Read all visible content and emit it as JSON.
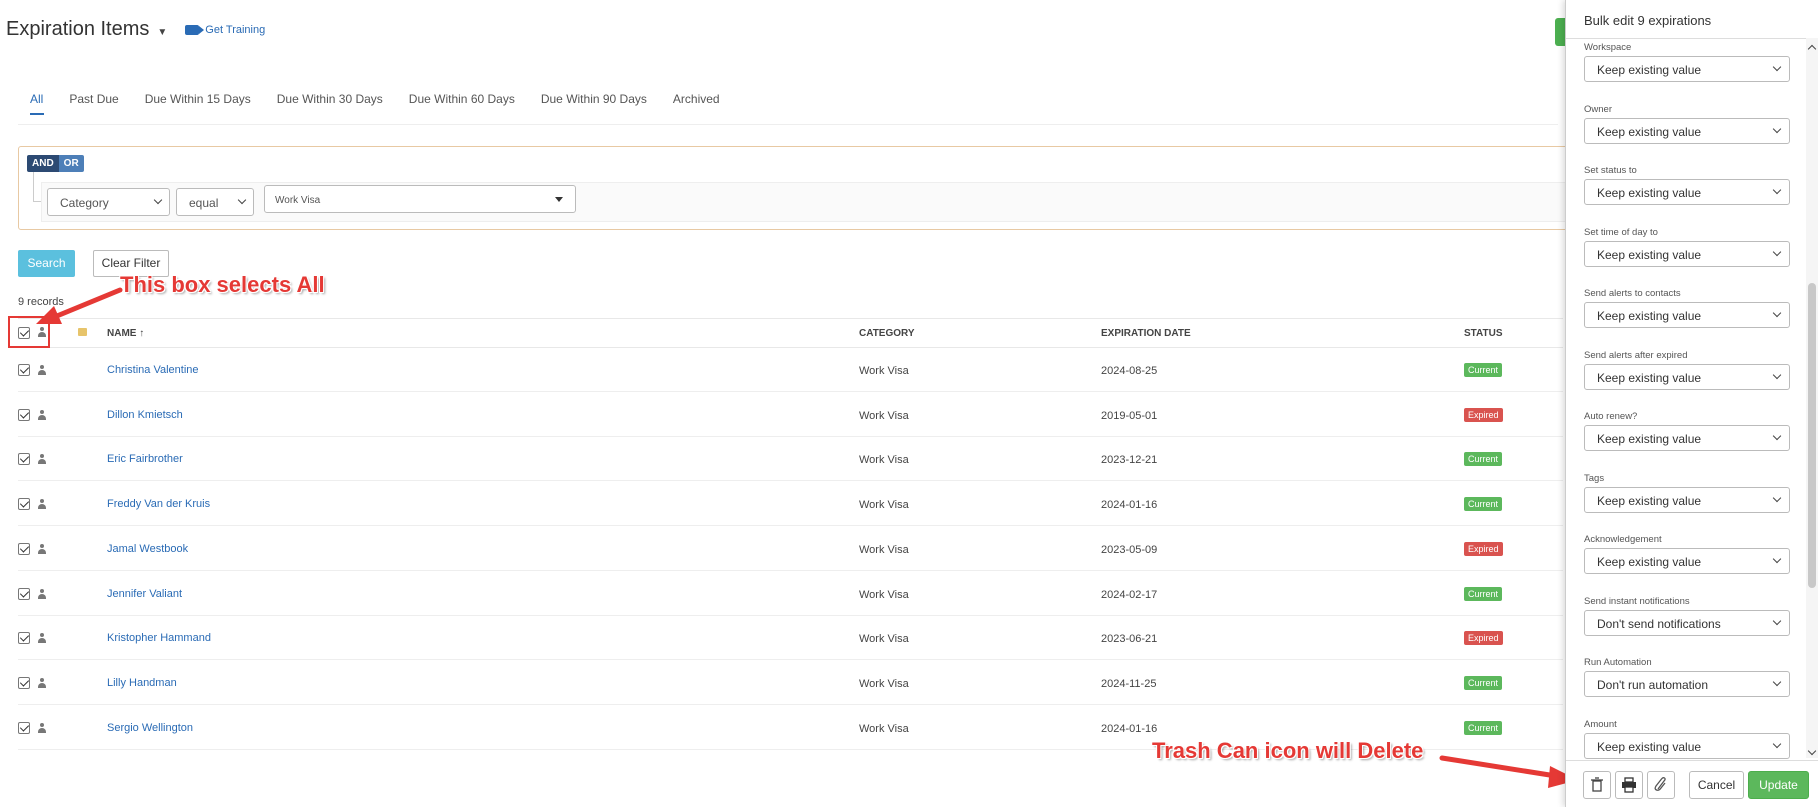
{
  "header": {
    "title": "Expiration Items",
    "training_label": "Get Training"
  },
  "tabs": [
    {
      "label": "All"
    },
    {
      "label": "Past Due"
    },
    {
      "label": "Due Within 15 Days"
    },
    {
      "label": "Due Within 30 Days"
    },
    {
      "label": "Due Within 60 Days"
    },
    {
      "label": "Due Within 90 Days"
    },
    {
      "label": "Archived"
    }
  ],
  "filter": {
    "and_label": "AND",
    "or_label": "OR",
    "field": "Category",
    "operator": "equal",
    "value": "Work Visa"
  },
  "actions": {
    "search_label": "Search",
    "clear_label": "Clear Filter"
  },
  "records_count": "9 records",
  "table": {
    "columns": {
      "name": "NAME ↑",
      "category": "CATEGORY",
      "expiration": "EXPIRATION DATE",
      "status": "STATUS"
    },
    "rows": [
      {
        "name": "Christina Valentine",
        "category": "Work Visa",
        "date": "2024-08-25",
        "status": "Current"
      },
      {
        "name": "Dillon Kmietsch",
        "category": "Work Visa",
        "date": "2019-05-01",
        "status": "Expired"
      },
      {
        "name": "Eric Fairbrother",
        "category": "Work Visa",
        "date": "2023-12-21",
        "status": "Current"
      },
      {
        "name": "Freddy Van der Kruis",
        "category": "Work Visa",
        "date": "2024-01-16",
        "status": "Current"
      },
      {
        "name": "Jamal Westbook",
        "category": "Work Visa",
        "date": "2023-05-09",
        "status": "Expired"
      },
      {
        "name": "Jennifer Valiant",
        "category": "Work Visa",
        "date": "2024-02-17",
        "status": "Current"
      },
      {
        "name": "Kristopher Hammand",
        "category": "Work Visa",
        "date": "2023-06-21",
        "status": "Expired"
      },
      {
        "name": "Lilly Handman",
        "category": "Work Visa",
        "date": "2024-11-25",
        "status": "Current"
      },
      {
        "name": "Sergio Wellington",
        "category": "Work Visa",
        "date": "2024-01-16",
        "status": "Current"
      }
    ]
  },
  "annotations": {
    "select_all": "This box selects All",
    "trash": "Trash Can icon will Delete"
  },
  "panel": {
    "title": "Bulk edit 9 expirations",
    "fields": [
      {
        "label": "Workspace",
        "value": "Keep existing value"
      },
      {
        "label": "Owner",
        "value": "Keep existing value"
      },
      {
        "label": "Set status to",
        "value": "Keep existing value"
      },
      {
        "label": "Set time of day to",
        "value": "Keep existing value"
      },
      {
        "label": "Send alerts to contacts",
        "value": "Keep existing value"
      },
      {
        "label": "Send alerts after expired",
        "value": "Keep existing value"
      },
      {
        "label": "Auto renew?",
        "value": "Keep existing value"
      },
      {
        "label": "Tags",
        "value": "Keep existing value"
      },
      {
        "label": "Acknowledgement",
        "value": "Keep existing value"
      },
      {
        "label": "Send instant notifications",
        "value": "Don't send notifications"
      },
      {
        "label": "Run Automation",
        "value": "Don't run automation"
      },
      {
        "label": "Amount",
        "value": "Keep existing value"
      }
    ],
    "cancel_label": "Cancel",
    "update_label": "Update"
  },
  "colors": {
    "current": "#5cb85c",
    "expired": "#d9534f",
    "accent": "#2a6bb5",
    "annotation": "#e53935"
  }
}
